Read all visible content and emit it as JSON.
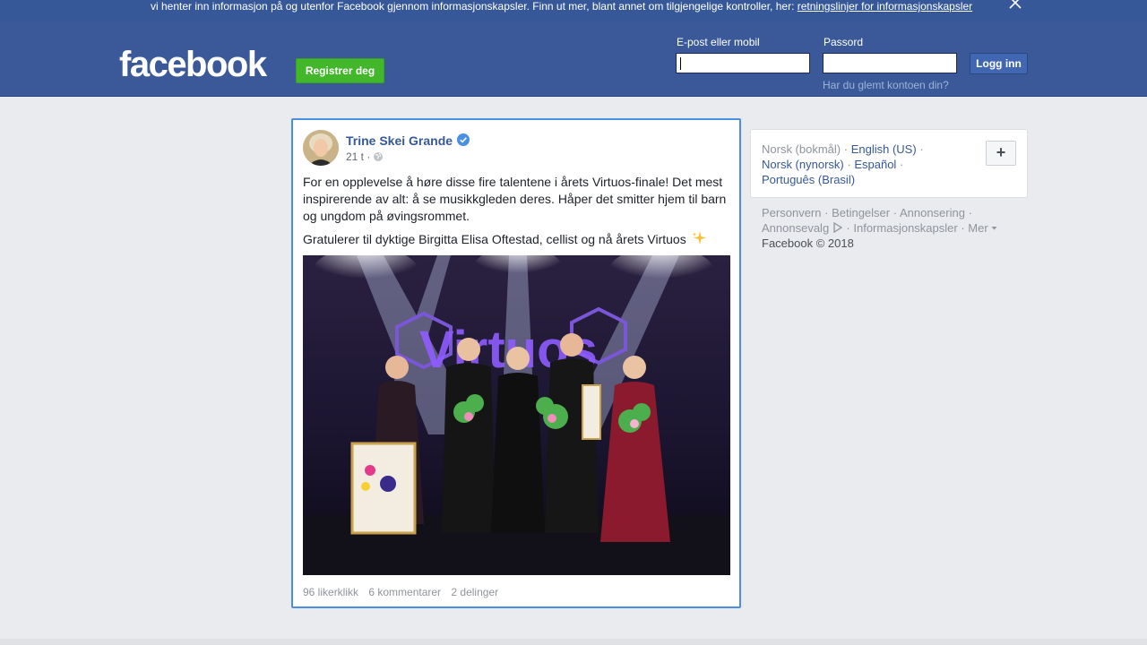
{
  "cookie_banner": {
    "text": "vi henter inn informasjon på og utenfor Facebook gjennom informasjonskapsler. Finn ut mer, blant annet om tilgjengelige kontroller, her: ",
    "link": "retningslinjer for informasjonskapsler"
  },
  "header": {
    "logo": "facebook",
    "register_label": "Registrer deg",
    "email_label": "E-post eller mobil",
    "password_label": "Passord",
    "login_label": "Logg inn",
    "forgot_label": "Har du glemt kontoen din?"
  },
  "post": {
    "author": "Trine Skei Grande",
    "time": "21 t ·",
    "text1": "For en opplevelse å høre disse fire talentene i årets Virtuos-finale! Det mest inspirerende av alt: å se musikkgleden deres. Håper det smitter hjem til barn og ungdom på øvingsrommet.",
    "text2": "Gratulerer til dyktige Birgitta Elisa Oftestad, cellist og nå årets Virtuos",
    "photo_sign": "Virtuos",
    "likes": "96 likerklikk",
    "comments": "6 kommentarer",
    "shares": "2 delinger"
  },
  "languages": {
    "current": "Norsk (bokmål)",
    "items": [
      "English (US)",
      "Norsk (nynorsk)",
      "Español",
      "Português (Brasil)"
    ],
    "add_label": "+"
  },
  "footer": {
    "links": [
      "Personvern",
      "Betingelser",
      "Annonsering",
      "Annonsevalg",
      "Informasjonskapsler",
      "Mer"
    ],
    "copyright": "Facebook © 2018"
  },
  "colors": {
    "brand_blue": "#3b5998",
    "link_blue": "#365899",
    "green": "#42b72a",
    "page_bg": "#e9ebee"
  }
}
